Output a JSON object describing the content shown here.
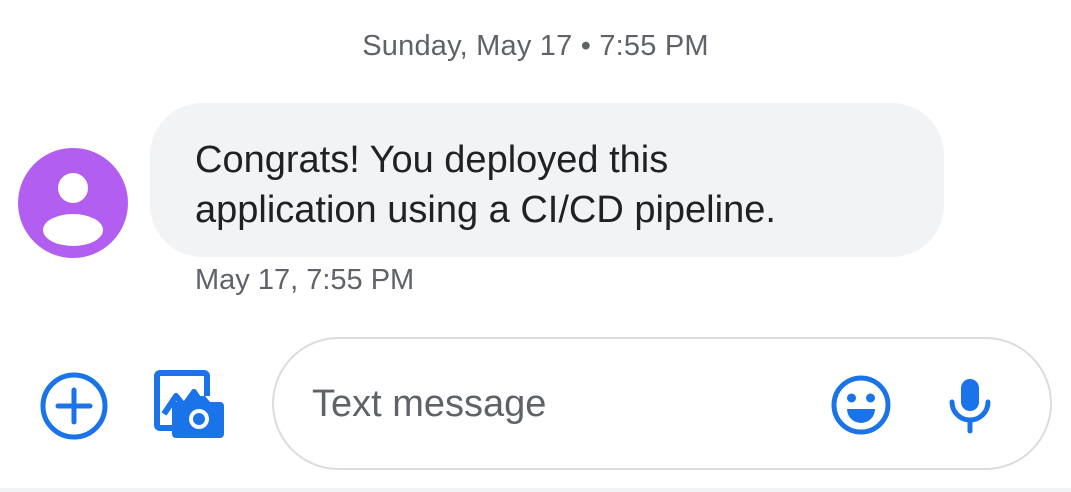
{
  "conversation": {
    "date_header": "Sunday, May 17 • 7:55 PM",
    "messages": [
      {
        "lines": [
          "Congrats! You deployed this",
          "application using a CI/CD pipeline."
        ],
        "timestamp": "May 17, 7:55 PM",
        "avatar_color": "#b25ef1"
      }
    ]
  },
  "composer": {
    "placeholder": "Text message",
    "icons": {
      "attach": "add-circle-icon",
      "gallery": "image-camera-icon",
      "emoji": "emoji-icon",
      "voice": "microphone-icon"
    }
  },
  "colors": {
    "accent": "#1a73e8",
    "bubble": "#f1f3f4",
    "text": "#202124",
    "secondary_text": "#5f6368"
  }
}
